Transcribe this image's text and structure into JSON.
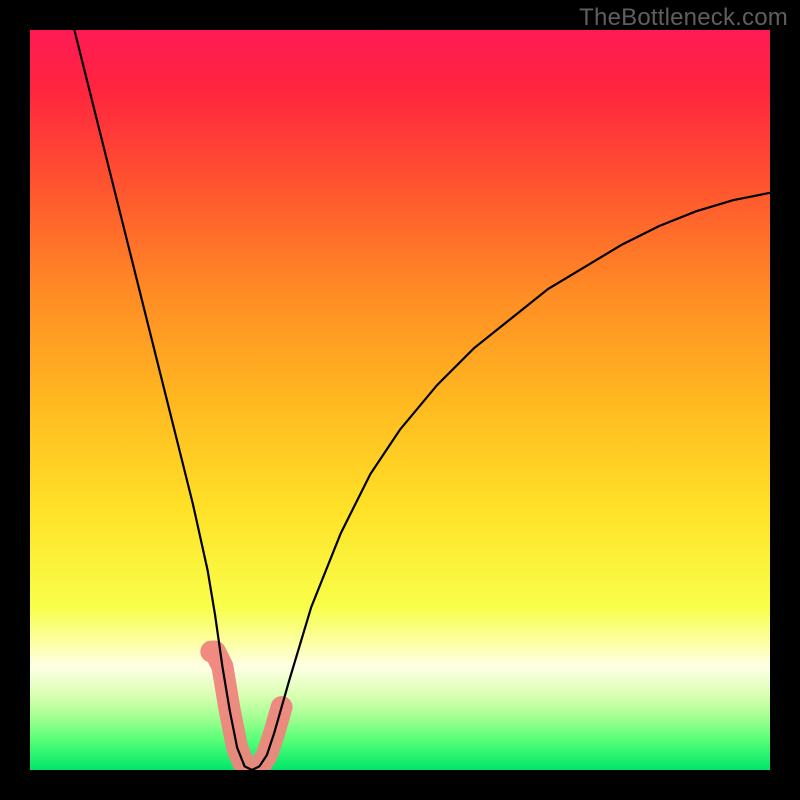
{
  "watermark": "TheBottleneck.com",
  "chart_data": {
    "type": "line",
    "title": "",
    "xlabel": "",
    "ylabel": "",
    "xlim": [
      0,
      100
    ],
    "ylim": [
      0,
      100
    ],
    "background_gradient": {
      "stops": [
        {
          "pos": 0.0,
          "color": "#ff1a55"
        },
        {
          "pos": 0.08,
          "color": "#ff253f"
        },
        {
          "pos": 0.2,
          "color": "#ff5030"
        },
        {
          "pos": 0.35,
          "color": "#ff8a25"
        },
        {
          "pos": 0.5,
          "color": "#ffb820"
        },
        {
          "pos": 0.65,
          "color": "#ffe228"
        },
        {
          "pos": 0.78,
          "color": "#f8ff4a"
        },
        {
          "pos": 0.83,
          "color": "#fcffa8"
        },
        {
          "pos": 0.86,
          "color": "#ffffe5"
        },
        {
          "pos": 0.9,
          "color": "#d8ffb0"
        },
        {
          "pos": 0.93,
          "color": "#a0ff90"
        },
        {
          "pos": 0.96,
          "color": "#55ff78"
        },
        {
          "pos": 1.0,
          "color": "#00e66a"
        }
      ]
    },
    "series": [
      {
        "name": "bottleneck-curve",
        "color": "#000000",
        "x": [
          6,
          8,
          10,
          12,
          14,
          16,
          18,
          20,
          22,
          24,
          25,
          26,
          27,
          28,
          29,
          30,
          31,
          32,
          33,
          35,
          38,
          42,
          46,
          50,
          55,
          60,
          65,
          70,
          75,
          80,
          85,
          90,
          95,
          100
        ],
        "y": [
          100,
          92,
          84,
          76,
          68,
          60,
          52,
          44,
          36,
          27,
          21,
          14,
          8,
          3,
          0.5,
          0,
          0.5,
          2,
          5,
          12,
          22,
          32,
          40,
          46,
          52,
          57,
          61,
          65,
          68,
          71,
          73.5,
          75.5,
          77,
          78
        ]
      }
    ],
    "highlight_band": {
      "name": "optimal-band",
      "color": "#ef857d",
      "x_range": [
        24.5,
        34
      ],
      "y_range": [
        0,
        16
      ]
    }
  }
}
